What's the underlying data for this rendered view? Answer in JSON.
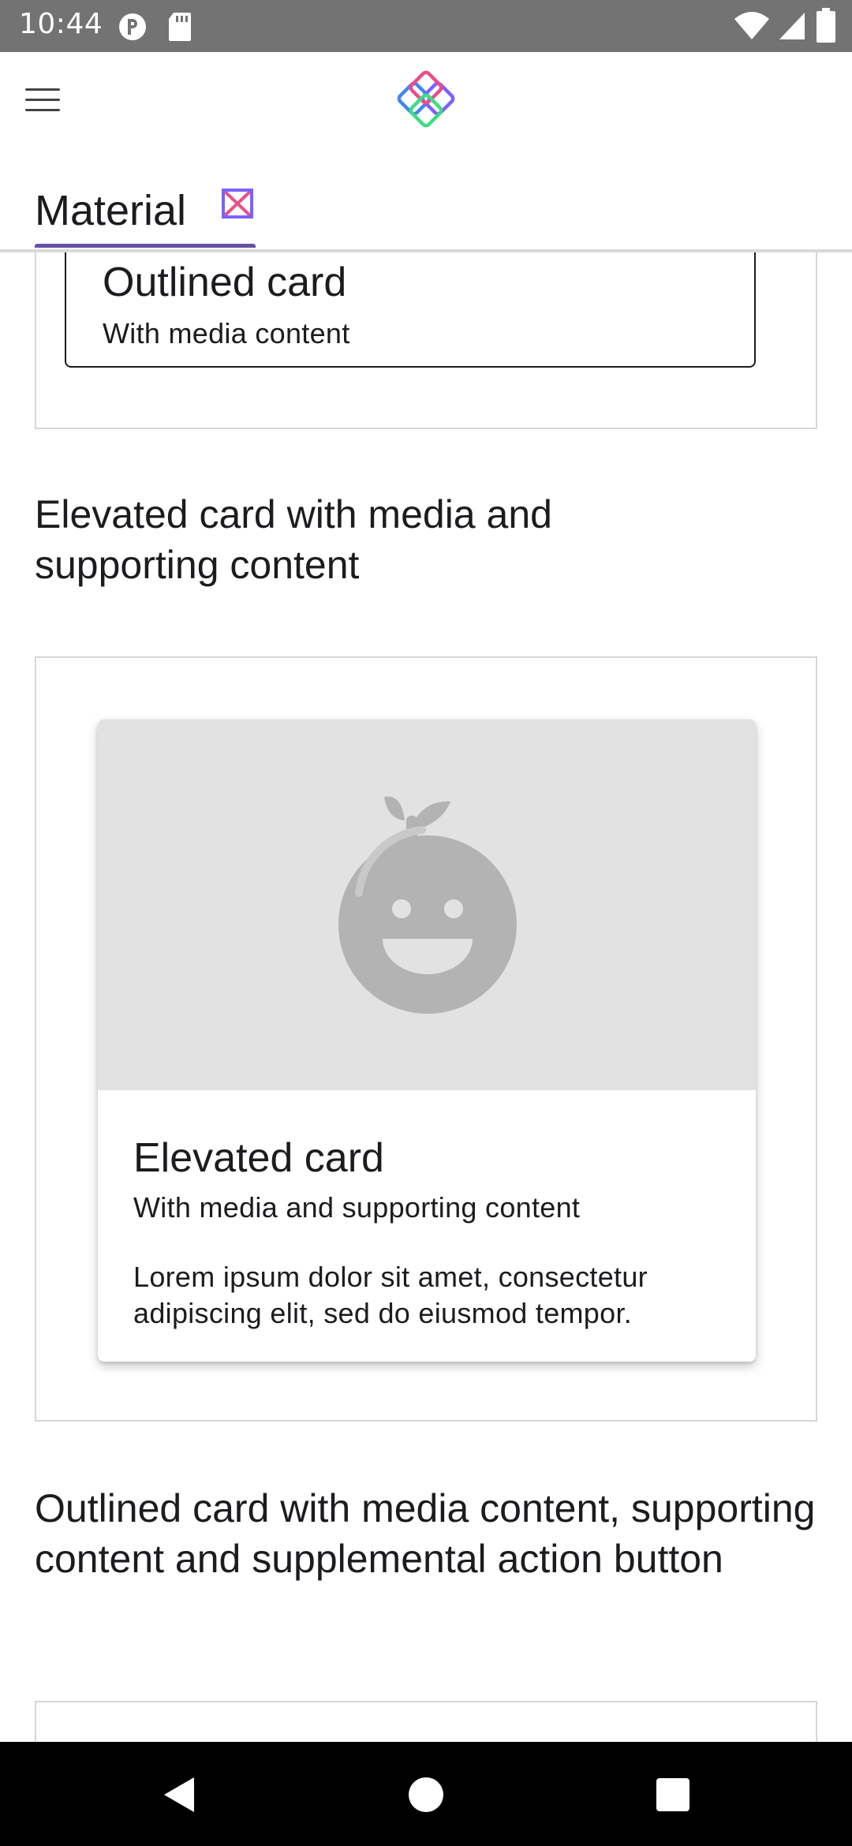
{
  "status_bar": {
    "time": "10:44",
    "icons": [
      "data-saver-icon",
      "sd-card-icon",
      "wifi-icon",
      "signal-icon",
      "battery-icon"
    ]
  },
  "app_bar": {
    "menu_icon": "hamburger-menu-icon",
    "logo_icon": "compose-catalog-logo",
    "tabs": [
      {
        "label": "Material",
        "icon": "material-logo-icon",
        "selected": true
      }
    ],
    "accent_color": "#6750a4"
  },
  "content": {
    "top_card": {
      "title": "Outlined card",
      "subtitle": "With media content"
    },
    "sections": [
      {
        "heading": "Elevated card with media and supporting content",
        "card": {
          "media_icon": "fruit-placeholder-icon",
          "title": "Elevated card",
          "subtitle": "With media and supporting content",
          "body": "Lorem ipsum dolor sit amet, consectetur adipiscing elit, sed do eiusmod tempor."
        }
      },
      {
        "heading": "Outlined card with media content, supporting content and supplemental action button"
      }
    ]
  },
  "nav_bar": {
    "icons": [
      "back-icon",
      "home-icon",
      "recents-icon"
    ]
  }
}
